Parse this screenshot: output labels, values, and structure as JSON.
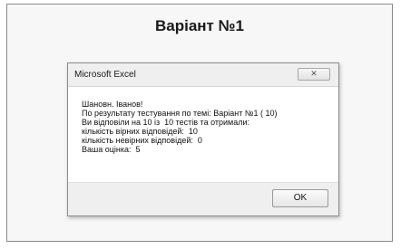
{
  "sheet": {
    "title": "Варіант №1"
  },
  "dialog": {
    "title": "Microsoft Excel",
    "close_glyph": "✕",
    "message_lines": [
      "Шановн. Іванов!",
      "По результату тестування по темі: Варіант №1 ( 10)",
      "Ви відповіли на 10 із  10 тестів та отримали:",
      "кількість вірних відповідей:  10",
      "кількість невірних відповідей:  0",
      "Ваша оцінка:  5"
    ],
    "ok_label": "OK"
  }
}
